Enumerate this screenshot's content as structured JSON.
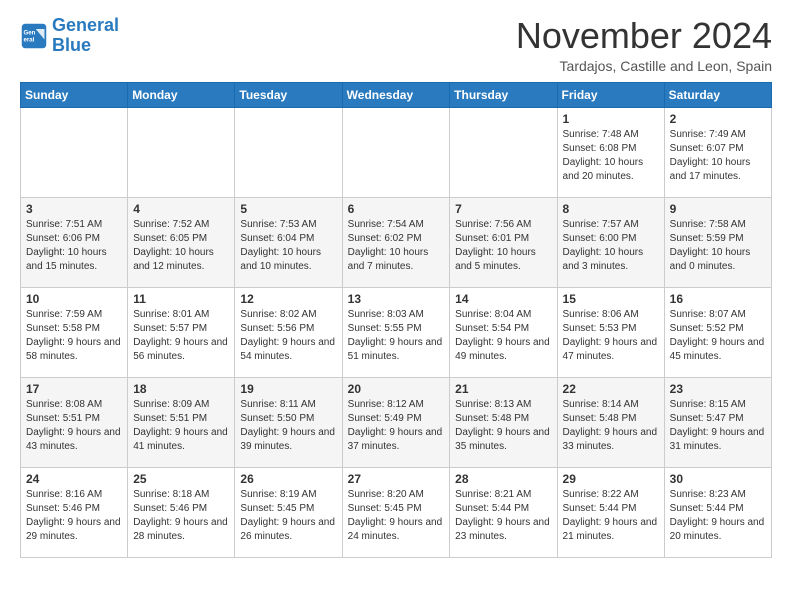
{
  "logo": {
    "line1": "General",
    "line2": "Blue"
  },
  "title": "November 2024",
  "subtitle": "Tardajos, Castille and Leon, Spain",
  "headers": [
    "Sunday",
    "Monday",
    "Tuesday",
    "Wednesday",
    "Thursday",
    "Friday",
    "Saturday"
  ],
  "weeks": [
    [
      {
        "day": "",
        "info": ""
      },
      {
        "day": "",
        "info": ""
      },
      {
        "day": "",
        "info": ""
      },
      {
        "day": "",
        "info": ""
      },
      {
        "day": "",
        "info": ""
      },
      {
        "day": "1",
        "info": "Sunrise: 7:48 AM\nSunset: 6:08 PM\nDaylight: 10 hours and 20 minutes."
      },
      {
        "day": "2",
        "info": "Sunrise: 7:49 AM\nSunset: 6:07 PM\nDaylight: 10 hours and 17 minutes."
      }
    ],
    [
      {
        "day": "3",
        "info": "Sunrise: 7:51 AM\nSunset: 6:06 PM\nDaylight: 10 hours and 15 minutes."
      },
      {
        "day": "4",
        "info": "Sunrise: 7:52 AM\nSunset: 6:05 PM\nDaylight: 10 hours and 12 minutes."
      },
      {
        "day": "5",
        "info": "Sunrise: 7:53 AM\nSunset: 6:04 PM\nDaylight: 10 hours and 10 minutes."
      },
      {
        "day": "6",
        "info": "Sunrise: 7:54 AM\nSunset: 6:02 PM\nDaylight: 10 hours and 7 minutes."
      },
      {
        "day": "7",
        "info": "Sunrise: 7:56 AM\nSunset: 6:01 PM\nDaylight: 10 hours and 5 minutes."
      },
      {
        "day": "8",
        "info": "Sunrise: 7:57 AM\nSunset: 6:00 PM\nDaylight: 10 hours and 3 minutes."
      },
      {
        "day": "9",
        "info": "Sunrise: 7:58 AM\nSunset: 5:59 PM\nDaylight: 10 hours and 0 minutes."
      }
    ],
    [
      {
        "day": "10",
        "info": "Sunrise: 7:59 AM\nSunset: 5:58 PM\nDaylight: 9 hours and 58 minutes."
      },
      {
        "day": "11",
        "info": "Sunrise: 8:01 AM\nSunset: 5:57 PM\nDaylight: 9 hours and 56 minutes."
      },
      {
        "day": "12",
        "info": "Sunrise: 8:02 AM\nSunset: 5:56 PM\nDaylight: 9 hours and 54 minutes."
      },
      {
        "day": "13",
        "info": "Sunrise: 8:03 AM\nSunset: 5:55 PM\nDaylight: 9 hours and 51 minutes."
      },
      {
        "day": "14",
        "info": "Sunrise: 8:04 AM\nSunset: 5:54 PM\nDaylight: 9 hours and 49 minutes."
      },
      {
        "day": "15",
        "info": "Sunrise: 8:06 AM\nSunset: 5:53 PM\nDaylight: 9 hours and 47 minutes."
      },
      {
        "day": "16",
        "info": "Sunrise: 8:07 AM\nSunset: 5:52 PM\nDaylight: 9 hours and 45 minutes."
      }
    ],
    [
      {
        "day": "17",
        "info": "Sunrise: 8:08 AM\nSunset: 5:51 PM\nDaylight: 9 hours and 43 minutes."
      },
      {
        "day": "18",
        "info": "Sunrise: 8:09 AM\nSunset: 5:51 PM\nDaylight: 9 hours and 41 minutes."
      },
      {
        "day": "19",
        "info": "Sunrise: 8:11 AM\nSunset: 5:50 PM\nDaylight: 9 hours and 39 minutes."
      },
      {
        "day": "20",
        "info": "Sunrise: 8:12 AM\nSunset: 5:49 PM\nDaylight: 9 hours and 37 minutes."
      },
      {
        "day": "21",
        "info": "Sunrise: 8:13 AM\nSunset: 5:48 PM\nDaylight: 9 hours and 35 minutes."
      },
      {
        "day": "22",
        "info": "Sunrise: 8:14 AM\nSunset: 5:48 PM\nDaylight: 9 hours and 33 minutes."
      },
      {
        "day": "23",
        "info": "Sunrise: 8:15 AM\nSunset: 5:47 PM\nDaylight: 9 hours and 31 minutes."
      }
    ],
    [
      {
        "day": "24",
        "info": "Sunrise: 8:16 AM\nSunset: 5:46 PM\nDaylight: 9 hours and 29 minutes."
      },
      {
        "day": "25",
        "info": "Sunrise: 8:18 AM\nSunset: 5:46 PM\nDaylight: 9 hours and 28 minutes."
      },
      {
        "day": "26",
        "info": "Sunrise: 8:19 AM\nSunset: 5:45 PM\nDaylight: 9 hours and 26 minutes."
      },
      {
        "day": "27",
        "info": "Sunrise: 8:20 AM\nSunset: 5:45 PM\nDaylight: 9 hours and 24 minutes."
      },
      {
        "day": "28",
        "info": "Sunrise: 8:21 AM\nSunset: 5:44 PM\nDaylight: 9 hours and 23 minutes."
      },
      {
        "day": "29",
        "info": "Sunrise: 8:22 AM\nSunset: 5:44 PM\nDaylight: 9 hours and 21 minutes."
      },
      {
        "day": "30",
        "info": "Sunrise: 8:23 AM\nSunset: 5:44 PM\nDaylight: 9 hours and 20 minutes."
      }
    ]
  ]
}
